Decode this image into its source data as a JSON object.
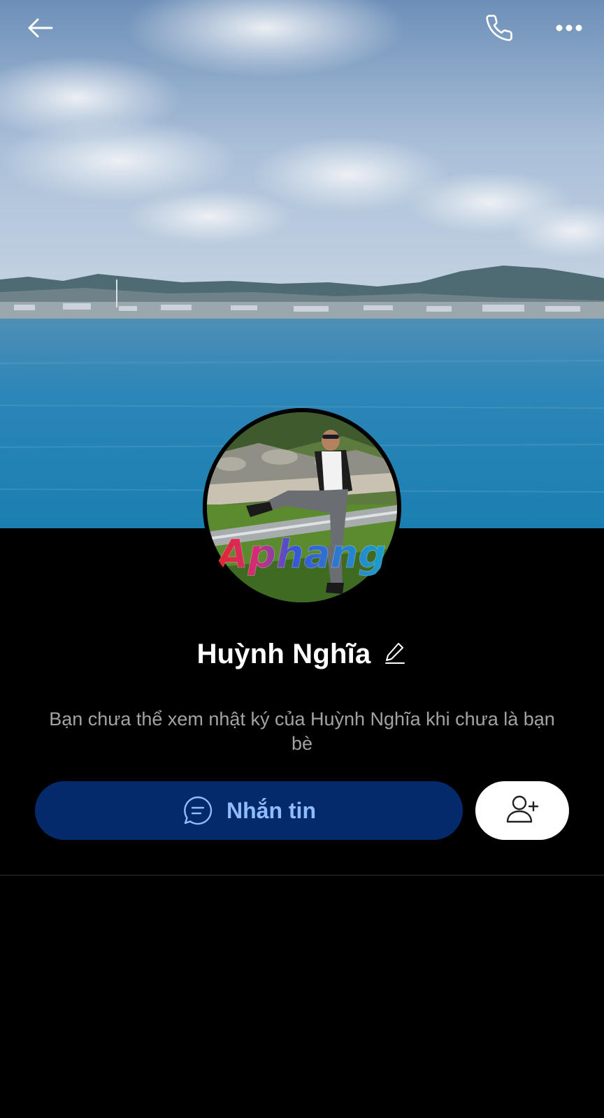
{
  "header": {
    "icons": {
      "back": "arrow-left-icon",
      "call": "phone-icon",
      "more": "more-horizontal-icon"
    }
  },
  "profile": {
    "name": "Huỳnh Nghĩa",
    "watermark": "Aphang",
    "notice": "Bạn chưa thể xem nhật ký của Huỳnh Nghĩa khi chưa là bạn bè"
  },
  "actions": {
    "message_label": "Nhắn tin",
    "message_icon": "chat-bubble-icon",
    "add_friend_icon": "add-user-icon"
  },
  "colors": {
    "background": "#000000",
    "message_button_bg": "#052a6b",
    "message_button_text": "#8fbcff",
    "notice_text": "#a3a3a3"
  }
}
